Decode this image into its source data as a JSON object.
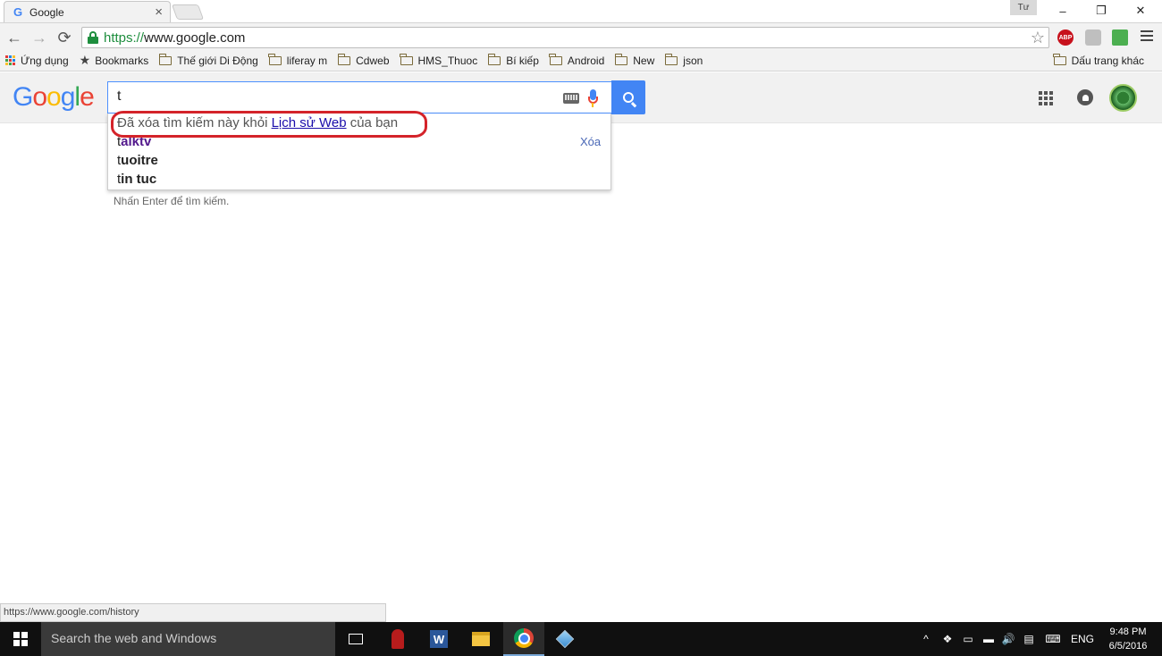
{
  "tab": {
    "title": "Google",
    "favicon": "G",
    "close": "×"
  },
  "window": {
    "user_label": "Tư",
    "minimize": "–",
    "restore": "❐",
    "close": "✕"
  },
  "nav": {
    "back": "←",
    "forward": "→",
    "reload": "⟳"
  },
  "omnibox": {
    "scheme": "https://",
    "rest": "www.google.com",
    "star": "☆"
  },
  "extensions": [
    {
      "name": "adblock-plus-icon",
      "label": "ABP",
      "color": "#c7111c"
    },
    {
      "name": "shield-extension-icon",
      "label": "",
      "color": "#bfbfbf"
    },
    {
      "name": "photo-extension-icon",
      "label": "",
      "color": "#4caf50"
    }
  ],
  "bookmarks": {
    "apps": "Ứng dụng",
    "bookmarks": "Bookmarks",
    "folders": [
      "Thế giới Di Động",
      "liferay m",
      "Cdweb",
      "HMS_Thuoc",
      "Bí kiếp",
      "Android",
      "New",
      "json"
    ],
    "other": "Dấu trang khác"
  },
  "google": {
    "logo_letters": [
      {
        "ch": "G",
        "color": "#4285f4"
      },
      {
        "ch": "o",
        "color": "#ea4335"
      },
      {
        "ch": "o",
        "color": "#fbbc05"
      },
      {
        "ch": "g",
        "color": "#4285f4"
      },
      {
        "ch": "l",
        "color": "#34a853"
      },
      {
        "ch": "e",
        "color": "#ea4335"
      }
    ],
    "query": "t"
  },
  "suggestions": {
    "notice_before": "Đã xóa tìm kiếm này khỏi ",
    "notice_link": "Lịch sử Web",
    "notice_after": " của bạn",
    "remove": "Xóa",
    "items": [
      {
        "prefix": "t",
        "rest": "alktv",
        "history": true
      },
      {
        "prefix": "t",
        "rest": "uoitre",
        "history": false
      },
      {
        "prefix": "t",
        "rest": "in tuc",
        "history": false
      }
    ],
    "hint": "Nhấn Enter để tìm kiếm."
  },
  "status": {
    "url": "https://www.google.com/history"
  },
  "taskbar": {
    "search_placeholder": "Search the web and Windows",
    "language": "ENG",
    "time": "9:48 PM",
    "date": "6/5/2016",
    "tray_icons": [
      "^",
      "❖",
      "▭",
      "▬",
      "🔊",
      "▤",
      "⌨"
    ]
  }
}
